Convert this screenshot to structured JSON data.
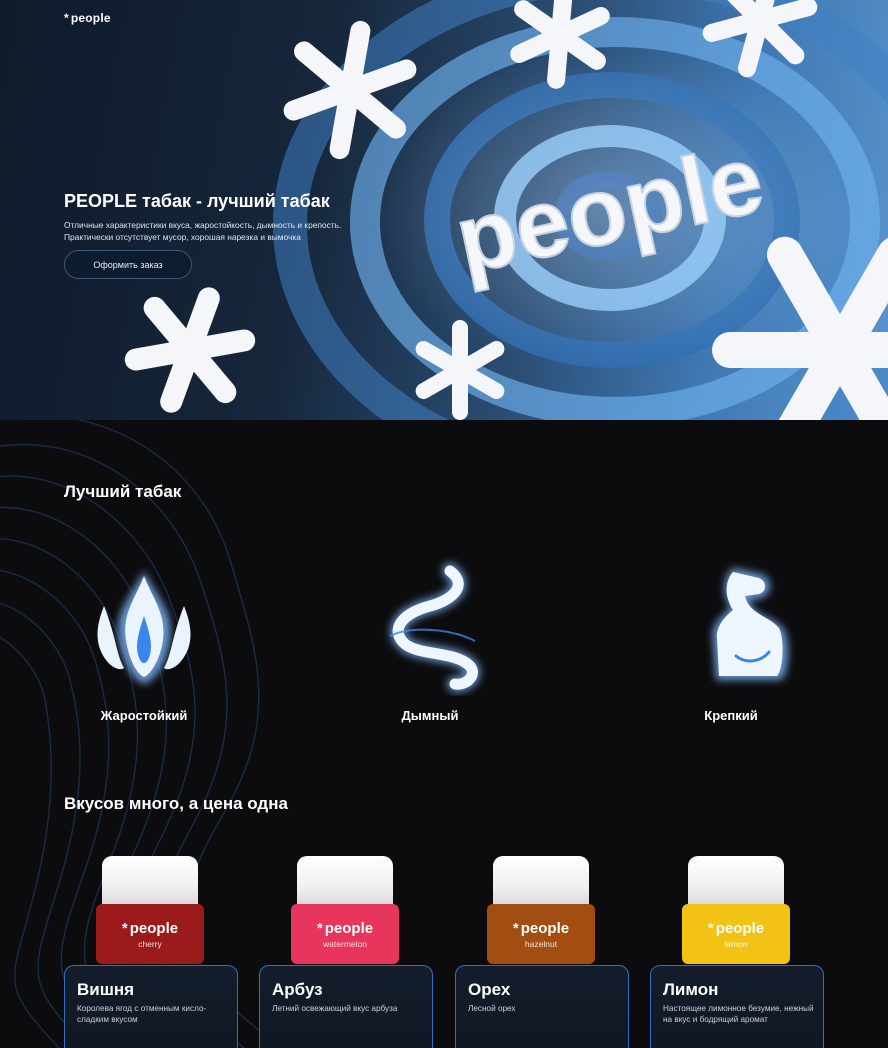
{
  "header": {
    "logo_star": "*",
    "logo_text": "people"
  },
  "hero": {
    "title": "PEOPLE табак - лучший табак",
    "description_line1": "Отличные характеристики вкуса, жаростойкость, дымность и крепость.",
    "description_line2": "Практически отсутствует мусор, хорошая нарезка и вымочка",
    "order_button": "Оформить заказ",
    "art_word": "people"
  },
  "features_section": {
    "title": "Лучший табак",
    "items": [
      {
        "label": "Жаростойкий",
        "icon": "fire-icon"
      },
      {
        "label": "Дымный",
        "icon": "smoke-icon"
      },
      {
        "label": "Крепкий",
        "icon": "muscle-icon"
      }
    ]
  },
  "flavors_section": {
    "title": "Вкусов много, а цена одна",
    "products": [
      {
        "brand": "people",
        "flavor_en": "cherry",
        "name": "Вишня",
        "description": "Королева ягод с отменным кисло-сладким вкусом",
        "color": "#9b1a1c"
      },
      {
        "brand": "people",
        "flavor_en": "watermelon",
        "name": "Арбуз",
        "description": "Летний освежающий вкус арбуза",
        "color": "#e8355b"
      },
      {
        "brand": "people",
        "flavor_en": "hazelnut",
        "name": "Орех",
        "description": "Лесной орех",
        "color": "#a24d12"
      },
      {
        "brand": "people",
        "flavor_en": "lemon",
        "name": "Лимон",
        "description": "Настоящее лимонное безумие, нежный на вкус и бодрящий аромат",
        "color": "#f2c214"
      }
    ]
  },
  "colors": {
    "hero_blue": "#3f78b3",
    "card_border": "#2f6fc0",
    "background": "#0c0c0e"
  }
}
